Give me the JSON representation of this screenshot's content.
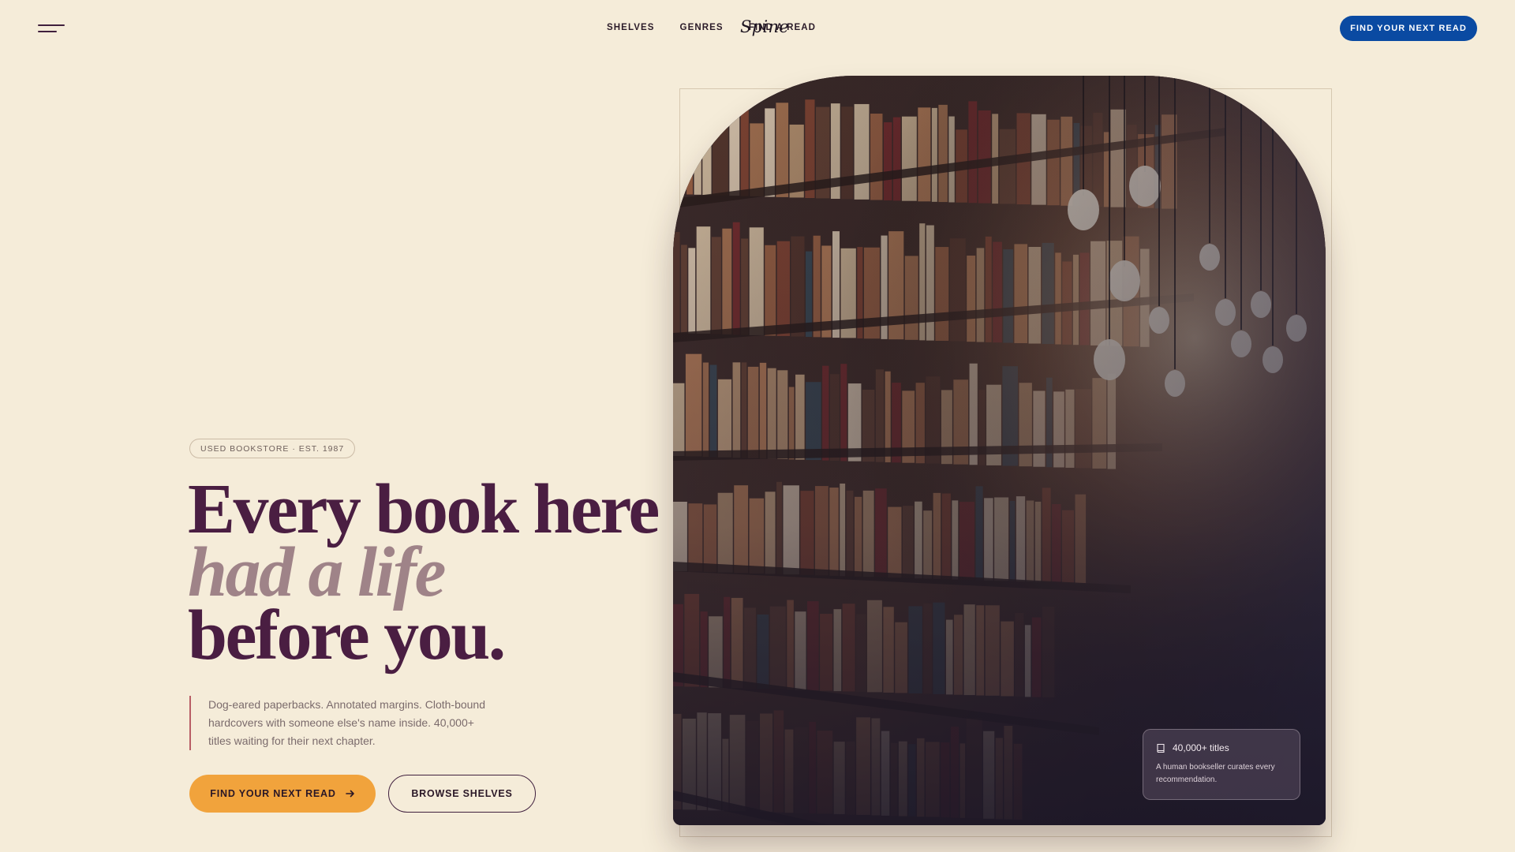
{
  "header": {
    "brand": "Spine",
    "nav": [
      "SHELVES",
      "GENRES",
      "FIND A READ"
    ],
    "cta": "FIND YOUR NEXT READ"
  },
  "hero": {
    "badge": "USED BOOKSTORE · EST. 1987",
    "headline": [
      "Every book here",
      "had a life",
      "before you."
    ],
    "lede": "Dog-eared paperbacks. Annotated margins. Cloth-bound hardcovers with someone else's name inside. 40,000+ titles waiting for their next chapter.",
    "primary_button": "FIND YOUR NEXT READ",
    "secondary_button": "BROWSE SHELVES"
  },
  "info_card": {
    "title": "40,000+ titles",
    "description": "A human bookseller curates every recommendation."
  },
  "colors": {
    "background": "#f5ecd9",
    "headline": "#4a1e42",
    "headline_accent": "#9f8388",
    "cta_blue": "#0a4aa2",
    "cta_orange": "#f1a33c",
    "lede_rule": "#b85d66"
  },
  "icons": {
    "menu": "hamburger-icon",
    "arrow": "arrow-right-icon",
    "book": "book-icon"
  }
}
